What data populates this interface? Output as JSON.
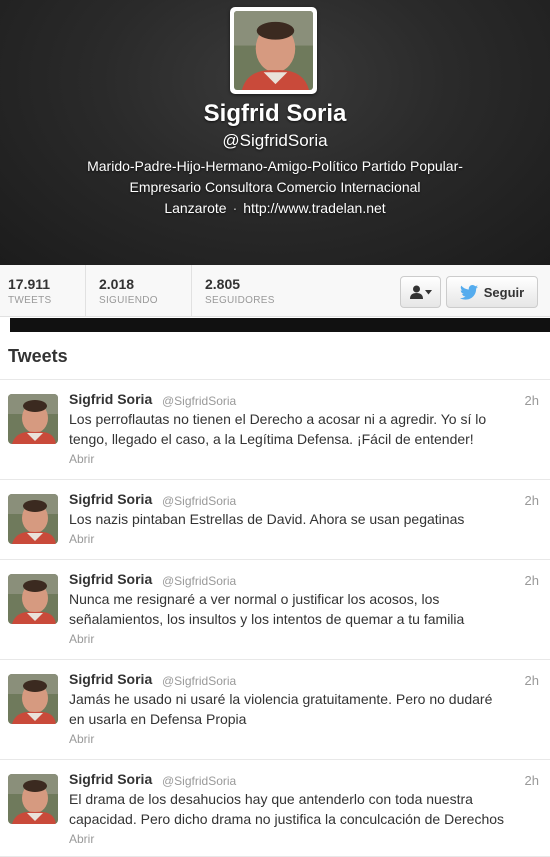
{
  "profile": {
    "name": "Sigfrid Soria",
    "handle": "@SigfridSoria",
    "bio_line1": "Marido-Padre-Hijo-Hermano-Amigo-Político Partido Popular-",
    "bio_line2": "Empresario Consultora Comercio Internacional",
    "location": "Lanzarote",
    "separator": "·",
    "url": "http://www.tradelan.net"
  },
  "stats": [
    {
      "value": "17.911",
      "label": "TWEETS"
    },
    {
      "value": "2.018",
      "label": "SIGUIENDO"
    },
    {
      "value": "2.805",
      "label": "SEGUIDORES"
    }
  ],
  "actions": {
    "user_menu_icon": "person-icon",
    "follow_label": "Seguir",
    "follow_icon": "twitter-bird-icon"
  },
  "tweets_title": "Tweets",
  "tweets": [
    {
      "name": "Sigfrid Soria",
      "handle": "@SigfridSoria",
      "time": "2h",
      "lines": [
        "Los perroflautas no tienen el Derecho a acosar ni a agredir. Yo sí lo",
        "tengo, llegado el caso, a la Legítima Defensa. ¡Fácil de entender!"
      ],
      "action": "Abrir"
    },
    {
      "name": "Sigfrid Soria",
      "handle": "@SigfridSoria",
      "time": "2h",
      "lines": [
        "Los nazis pintaban Estrellas de David. Ahora se usan pegatinas"
      ],
      "action": "Abrir"
    },
    {
      "name": "Sigfrid Soria",
      "handle": "@SigfridSoria",
      "time": "2h",
      "lines": [
        "Nunca me resignaré a ver normal o justificar los acosos, los",
        "señalamientos, los insultos y los intentos de quemar a tu familia"
      ],
      "action": "Abrir"
    },
    {
      "name": "Sigfrid Soria",
      "handle": "@SigfridSoria",
      "time": "2h",
      "lines": [
        "Jamás he usado ni usaré la violencia gratuitamente. Pero no dudaré",
        "en usarla en Defensa Propia"
      ],
      "action": "Abrir"
    },
    {
      "name": "Sigfrid Soria",
      "handle": "@SigfridSoria",
      "time": "2h",
      "lines": [
        "El drama de los desahucios hay que antenderlo con toda nuestra",
        "capacidad. Pero dicho drama no justifica la conculcación de Derechos"
      ],
      "action": "Abrir"
    }
  ],
  "colors": {
    "header_bg": "#2a2a2a",
    "follow_bird": "#55acee",
    "muted_text": "#999999"
  }
}
